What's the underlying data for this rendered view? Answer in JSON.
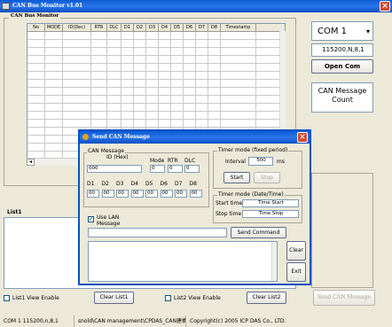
{
  "window": {
    "title": "CAN Bus Monitor v1.01"
  },
  "monitor": {
    "group_label": "CAN Bus Monitor",
    "columns": [
      "No",
      "MODE",
      "ID(Dec)",
      "RTR",
      "DLC",
      "D1",
      "D2",
      "D3",
      "D4",
      "D5",
      "D6",
      "D7",
      "D8",
      "Timestamp"
    ]
  },
  "right_panel": {
    "com_port": "COM 1",
    "baud": "115200,N,8,1",
    "open_com": "Open Com",
    "can_msg_count": "CAN Message Count"
  },
  "list1": {
    "label": "List1"
  },
  "bottom": {
    "list1_view_enable": "List1 View Enable",
    "clear_list1": "Clear List1",
    "list2_view_enable": "List2 View Enable",
    "clear_list2": "Clear List2",
    "send_can_message": "Send CAN Message"
  },
  "dialog": {
    "title": "Send CAN Message",
    "can_message": {
      "label": "CAN Message",
      "id_label": "ID (Hex)",
      "mode_label": "Mode",
      "rtr_label": "RTR",
      "dlc_label": "DLC",
      "id_value": "000",
      "mode_value": "0",
      "rtr_value": "0",
      "dlc_value": "0",
      "data_labels": [
        "D1",
        "D2",
        "D3",
        "D4",
        "D5",
        "D6",
        "D7",
        "D8"
      ],
      "data_values": [
        "00",
        "00",
        "00",
        "00",
        "00",
        "00",
        "00",
        "00"
      ]
    },
    "timer_fixed": {
      "label": "Timer mode (fixed period)",
      "interval_label": "Interval",
      "interval_value": "500",
      "interval_unit": "ms",
      "start": "Start",
      "stop": "Stop"
    },
    "timer_datetime": {
      "label": "Timer mode (Date/Time)",
      "start_time_label": "Start time",
      "start_time_value": "Time Start",
      "stop_time_label": "Stop time",
      "stop_time_value": "Time Stop"
    },
    "use_lan": "Use LAN Message",
    "send_command": "Send Command",
    "clear": "Clear",
    "exit": "Exit"
  },
  "status": {
    "port": "COM 1",
    "baud": "115200,n,8,1",
    "path": "snold\\CAN management\\CPDAS_CAN建構\\7565\\de",
    "copyright": "Copyright(c) 2005 ICP DAS Co., LTD."
  }
}
